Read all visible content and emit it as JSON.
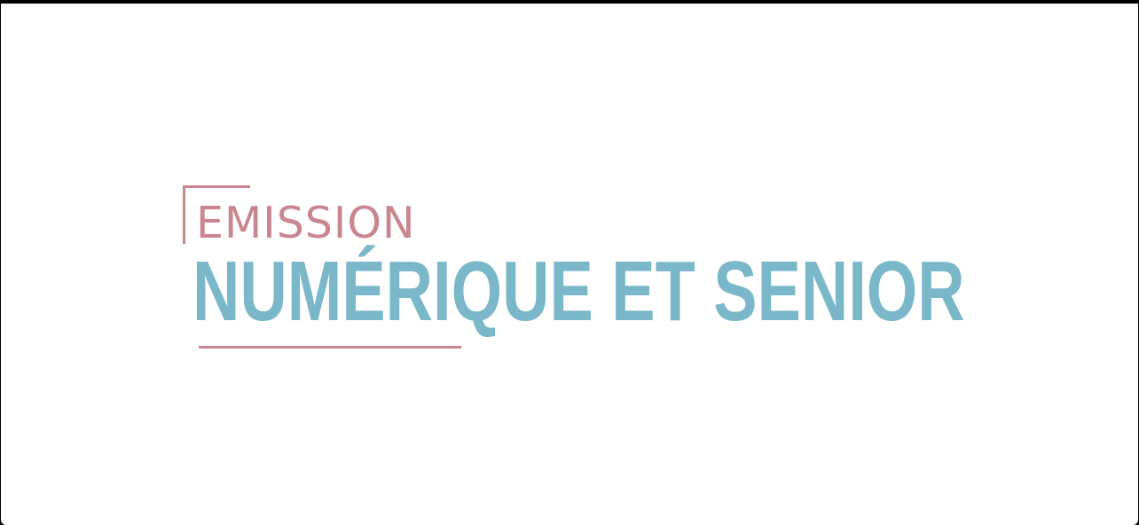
{
  "title_card": {
    "kicker": "EMISSION",
    "title": "NUMÉRIQUE ET SENIOR"
  },
  "colors": {
    "kicker": "#c9868f",
    "title": "#7ab7c8",
    "background": "#ffffff",
    "frame": "#000000"
  }
}
